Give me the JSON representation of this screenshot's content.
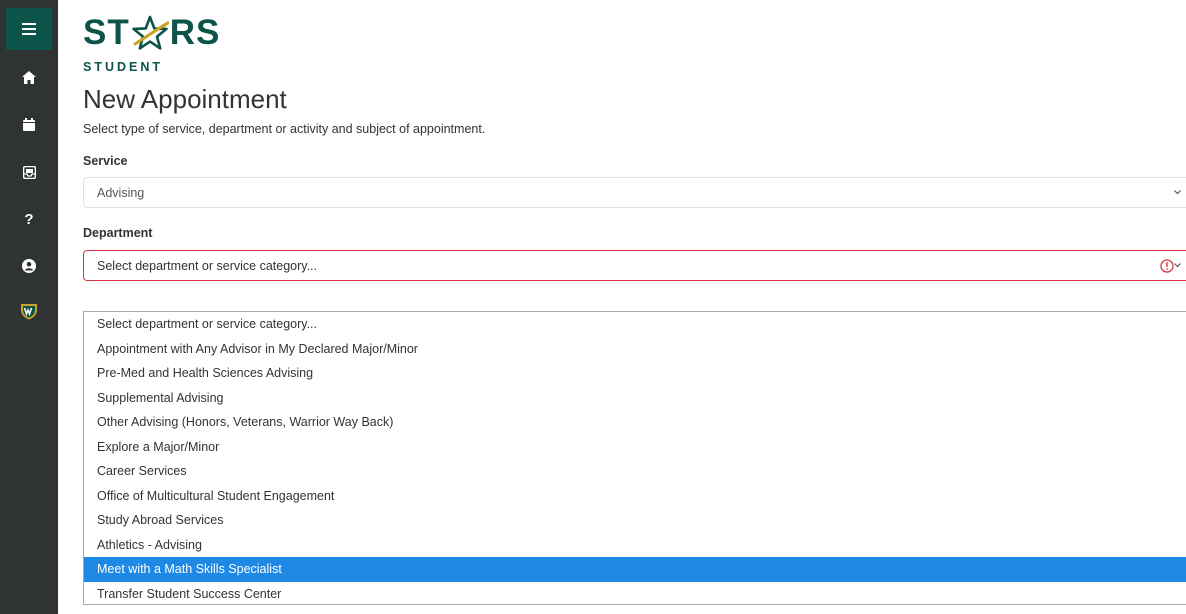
{
  "brand": {
    "logo_text": "ST★RS",
    "sub": "STUDENT",
    "colors": {
      "brand_green": "#0c5449",
      "star_gold": "#c9a227"
    }
  },
  "sidebar": {
    "items": [
      {
        "icon": "menu-icon"
      },
      {
        "icon": "home-icon"
      },
      {
        "icon": "calendar-icon"
      },
      {
        "icon": "inbox-icon"
      },
      {
        "icon": "help-icon"
      },
      {
        "icon": "user-icon"
      },
      {
        "icon": "wayne-state-shield-icon"
      }
    ]
  },
  "page": {
    "title": "New Appointment",
    "instructions": "Select type of service, department or activity and subject of appointment."
  },
  "service": {
    "label": "Service",
    "value": "Advising"
  },
  "department": {
    "label": "Department",
    "placeholder": "Select department or service category...",
    "validation_state": "invalid",
    "error_color": "#dc3545",
    "options": [
      "Select department or service category...",
      "Appointment with Any Advisor in My Declared Major/Minor",
      "Pre-Med and Health Sciences Advising",
      "Supplemental Advising",
      "Other Advising (Honors, Veterans, Warrior Way Back)",
      "Explore a Major/Minor",
      "Career Services",
      "Office of Multicultural Student Engagement",
      "Study Abroad Services",
      "Athletics - Advising",
      "Meet with a Math Skills Specialist",
      "Transfer Student Success Center"
    ],
    "highlighted_option": "Meet with a Math Skills Specialist",
    "highlight_color": "#1e88e5"
  }
}
